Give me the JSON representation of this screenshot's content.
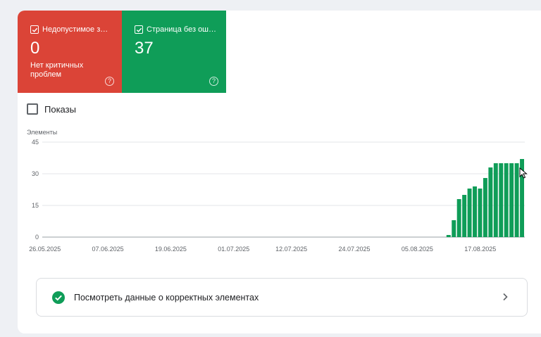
{
  "tiles": {
    "invalid": {
      "title": "Недопустимое з…",
      "value": "0",
      "subtitle": "Нет критичных проблем",
      "help": "?",
      "color": "#db4437"
    },
    "valid": {
      "title": "Страница без ош…",
      "value": "37",
      "help": "?",
      "color": "#0f9d58"
    }
  },
  "impressions": {
    "label": "Показы",
    "checked": false
  },
  "chart_data": {
    "type": "bar",
    "ylabel": "Элементы",
    "ylim": [
      0,
      45
    ],
    "yticks": [
      0,
      15,
      30,
      45
    ],
    "xtick_labels": [
      "26.05.2025",
      "07.06.2025",
      "19.06.2025",
      "01.07.2025",
      "12.07.2025",
      "24.07.2025",
      "05.08.2025",
      "17.08.2025"
    ],
    "series": [
      {
        "color": "#0f9d58",
        "points": [
          {
            "x": "11.08.2025",
            "y": 1
          },
          {
            "x": "12.08.2025",
            "y": 8
          },
          {
            "x": "13.08.2025",
            "y": 18
          },
          {
            "x": "14.08.2025",
            "y": 20
          },
          {
            "x": "15.08.2025",
            "y": 23
          },
          {
            "x": "16.08.2025",
            "y": 24
          },
          {
            "x": "17.08.2025",
            "y": 23
          },
          {
            "x": "18.08.2025",
            "y": 28
          },
          {
            "x": "19.08.2025",
            "y": 33
          },
          {
            "x": "20.08.2025",
            "y": 35
          },
          {
            "x": "21.08.2025",
            "y": 35
          },
          {
            "x": "22.08.2025",
            "y": 35
          },
          {
            "x": "23.08.2025",
            "y": 35
          },
          {
            "x": "24.08.2025",
            "y": 35
          },
          {
            "x": "25.08.2025",
            "y": 37
          }
        ]
      }
    ],
    "grid": true
  },
  "link": {
    "label": "Посмотреть данные о корректных элементах",
    "icon": "check-circle-icon",
    "accent": "#0f9d58"
  }
}
